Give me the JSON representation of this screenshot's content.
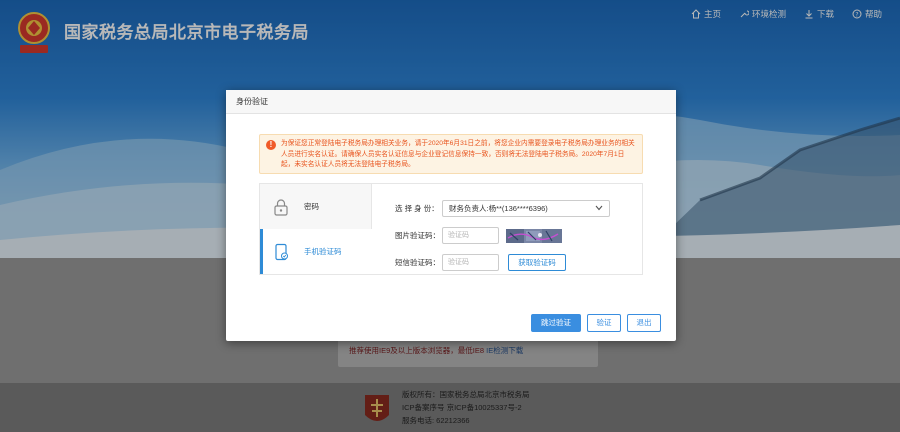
{
  "site": {
    "title": "国家税务总局北京市电子税务局",
    "emblem_text": "中国税务"
  },
  "topnav": [
    {
      "label": "主页",
      "icon": "home-icon"
    },
    {
      "label": "环境检测",
      "icon": "wrench-icon"
    },
    {
      "label": "下载",
      "icon": "download-icon"
    },
    {
      "label": "帮助",
      "icon": "help-icon"
    }
  ],
  "background_page": {
    "browser_tip": "推荐使用IE9及以上版本浏览器，最低IE8",
    "browser_tip_link": "IE检测下载"
  },
  "footer": {
    "copyright": "版权所有：国家税务总局北京市税务局",
    "icp": "ICP备案序号 京ICP备10025337号-2",
    "phone": "服务电话: 62212366"
  },
  "modal": {
    "title": "身份验证",
    "notice": "为保证您正常登陆电子税务局办理相关业务，请于2020年6月31日之前，将您企业内需要登录电子税务局办理业务的相关人员进行实名认证。请确保人员实名认证信息与企业登记信息保持一致，否则将无法登陆电子税务局。2020年7月1日起，未实名认证人员将无法登陆电子税务局。",
    "tabs": [
      {
        "label": "密码",
        "icon": "lock-icon",
        "active": false
      },
      {
        "label": "手机验证码",
        "icon": "phone-icon",
        "active": true
      }
    ],
    "identity_label": "选 择 身 份：",
    "identity_value": "财务负责人:杨**(136****6396)",
    "captcha_label": "图片验证码：",
    "captcha_placeholder": "验证码",
    "sms_label": "短信验证码：",
    "sms_placeholder": "验证码",
    "sms_button": "获取验证码",
    "buttons": {
      "skip": "跳过验证",
      "verify": "验证",
      "exit": "退出"
    }
  },
  "colors": {
    "accent": "#3a8ee0",
    "warning_text": "#e8531d",
    "warning_bg": "#fdf3e3",
    "header_blue": "#1d6bbd"
  }
}
